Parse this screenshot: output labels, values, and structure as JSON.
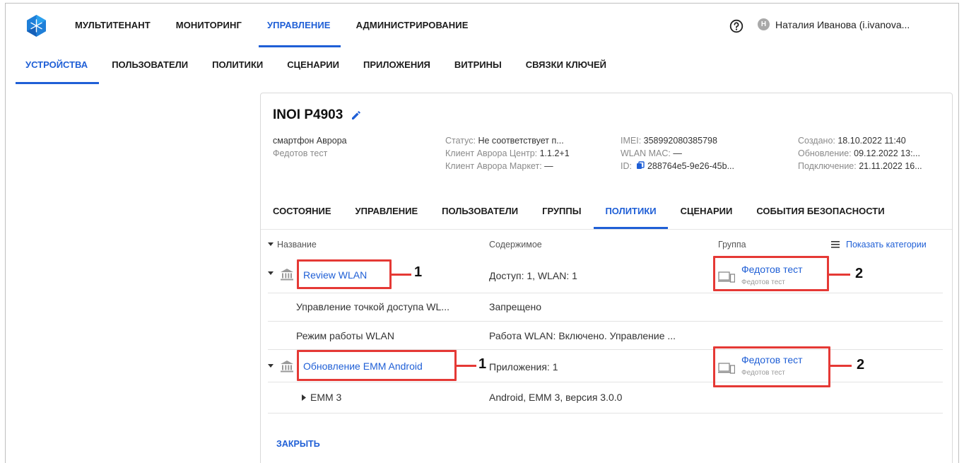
{
  "colors": {
    "accent": "#1f5fd6",
    "annotation": "#e53935"
  },
  "topnav": {
    "items": [
      {
        "label": "МУЛЬТИТЕНАНТ"
      },
      {
        "label": "МОНИТОРИНГ"
      },
      {
        "label": "УПРАВЛЕНИЕ",
        "active": true
      },
      {
        "label": "АДМИНИСТРИРОВАНИЕ"
      }
    ],
    "help_icon": "question-circle-icon",
    "user": {
      "initial": "Н",
      "name": "Наталия Иванова (i.ivanova..."
    }
  },
  "subnav": {
    "items": [
      {
        "label": "УСТРОЙСТВА",
        "active": true
      },
      {
        "label": "ПОЛЬЗОВАТЕЛИ"
      },
      {
        "label": "ПОЛИТИКИ"
      },
      {
        "label": "СЦЕНАРИИ"
      },
      {
        "label": "ПРИЛОЖЕНИЯ"
      },
      {
        "label": "ВИТРИНЫ"
      },
      {
        "label": "СВЯЗКИ КЛЮЧЕЙ"
      }
    ]
  },
  "device": {
    "title": "INOI P4903",
    "type": "смартфон Аврора",
    "group": "Федотов тест",
    "status_label": "Статус:",
    "status_value": "Не соответствует п...",
    "client_center_label": "Клиент Аврора Центр:",
    "client_center_value": "1.1.2+1",
    "client_market_label": "Клиент Аврора Маркет:",
    "client_market_value": "—",
    "imei_label": "IMEI:",
    "imei_value": "358992080385798",
    "wlan_mac_label": "WLAN MAC:",
    "wlan_mac_value": "—",
    "id_label": "ID:",
    "id_value": "288764e5-9e26-45b...",
    "created_label": "Создано:",
    "created_value": "18.10.2022 11:40",
    "updated_label": "Обновление:",
    "updated_value": "09.12.2022 13:...",
    "connected_label": "Подключение:",
    "connected_value": "21.11.2022 16..."
  },
  "tabs": [
    {
      "label": "СОСТОЯНИЕ"
    },
    {
      "label": "УПРАВЛЕНИЕ"
    },
    {
      "label": "ПОЛЬЗОВАТЕЛИ"
    },
    {
      "label": "ГРУППЫ"
    },
    {
      "label": "ПОЛИТИКИ",
      "active": true
    },
    {
      "label": "СЦЕНАРИИ"
    },
    {
      "label": "СОБЫТИЯ БЕЗОПАСНОСТИ"
    }
  ],
  "table": {
    "col_name": "Название",
    "col_content": "Содержимое",
    "col_group": "Группа",
    "show_categories": "Показать категории",
    "rows": [
      {
        "name": "Review WLAN",
        "content": "Доступ: 1, WLAN: 1",
        "group": "Федотов тест",
        "group_sub": "Федотов тест"
      },
      {
        "name": "Управление точкой доступа WL...",
        "content": "Запрещено"
      },
      {
        "name": "Режим работы WLAN",
        "content": "Работа WLAN: Включено. Управление ..."
      },
      {
        "name": "Обновление EMM Android",
        "content": "Приложения: 1",
        "group": "Федотов тест",
        "group_sub": "Федотов тест"
      },
      {
        "name": "EMM 3",
        "content": "Android, EMM 3, версия 3.0.0"
      }
    ]
  },
  "annotations": {
    "one": "1",
    "two": "2"
  },
  "close_label": "ЗАКРЫТЬ"
}
